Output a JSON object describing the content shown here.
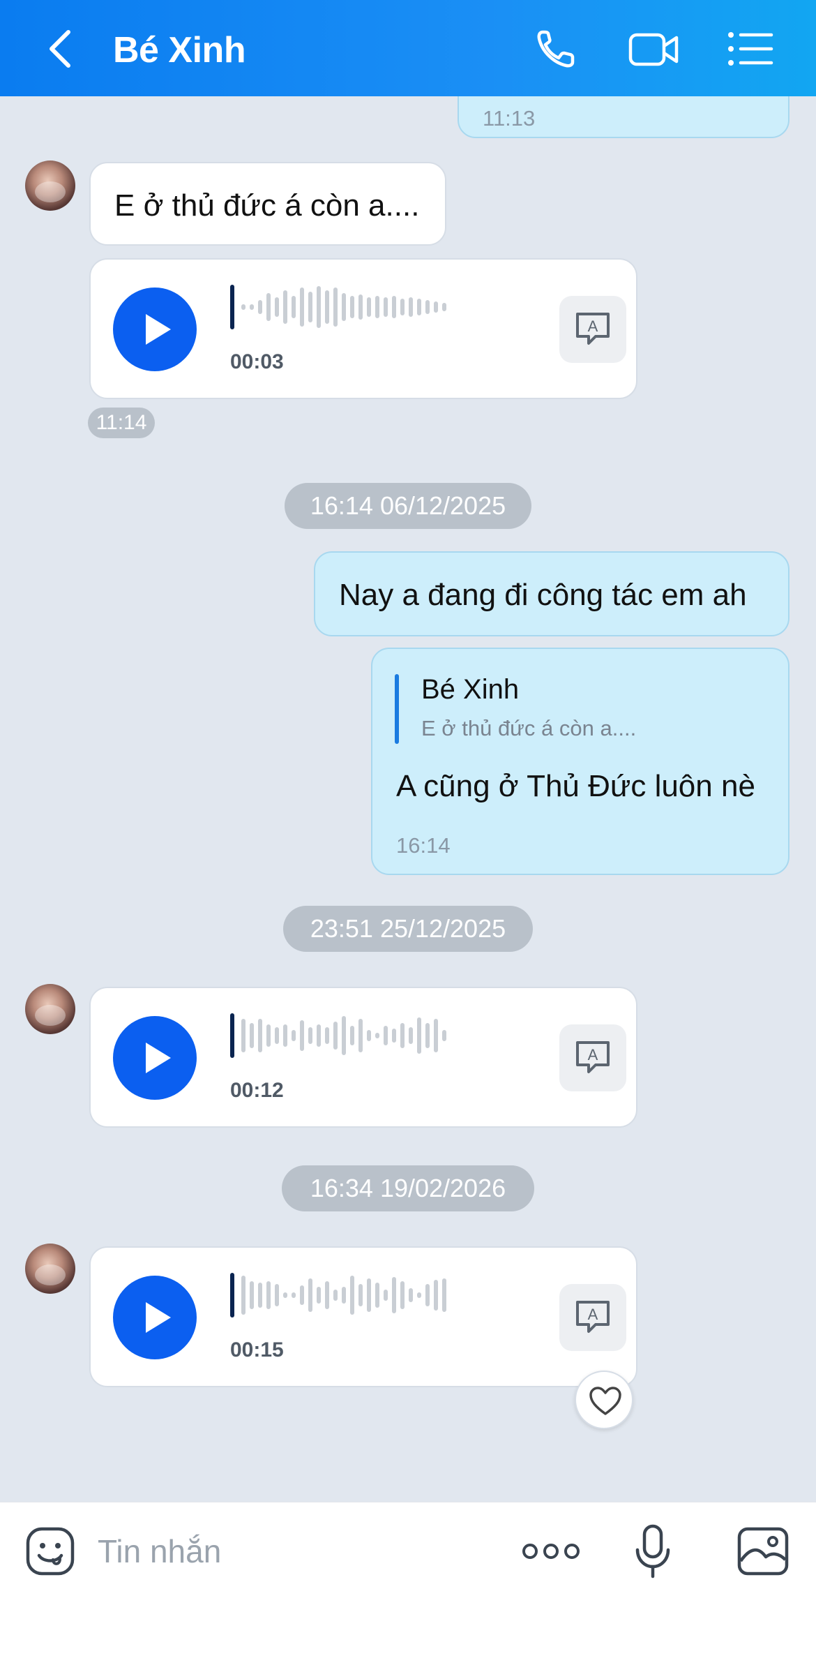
{
  "header": {
    "title": "Bé Xinh",
    "icons": [
      "back-icon",
      "phone-icon",
      "video-icon",
      "menu-list-icon"
    ]
  },
  "messages": {
    "top_out_time": "11:13",
    "in_text_1": "E ở thủ đức á còn a....",
    "voice_1_duration": "00:03",
    "small_time_1": "11:14",
    "divider_1": "16:14 06/12/2025",
    "out_text_1": "Nay a đang đi công tác em ah",
    "reply": {
      "quote_name": "Bé Xinh",
      "quote_text": "E ở thủ đức á còn a....",
      "text": "A cũng ở Thủ Đức luôn nè",
      "time": "16:14"
    },
    "divider_2": "23:51 25/12/2025",
    "voice_2_duration": "00:12",
    "divider_3": "16:34 19/02/2026",
    "voice_3_duration": "00:15"
  },
  "composer": {
    "placeholder": "Tin nhắn"
  },
  "colors": {
    "header_start": "#0a7cf0",
    "header_end": "#12a6f2",
    "play_blue": "#0b5ff0",
    "out_bubble": "#cdeefb",
    "chat_bg": "#e1e7ef"
  }
}
